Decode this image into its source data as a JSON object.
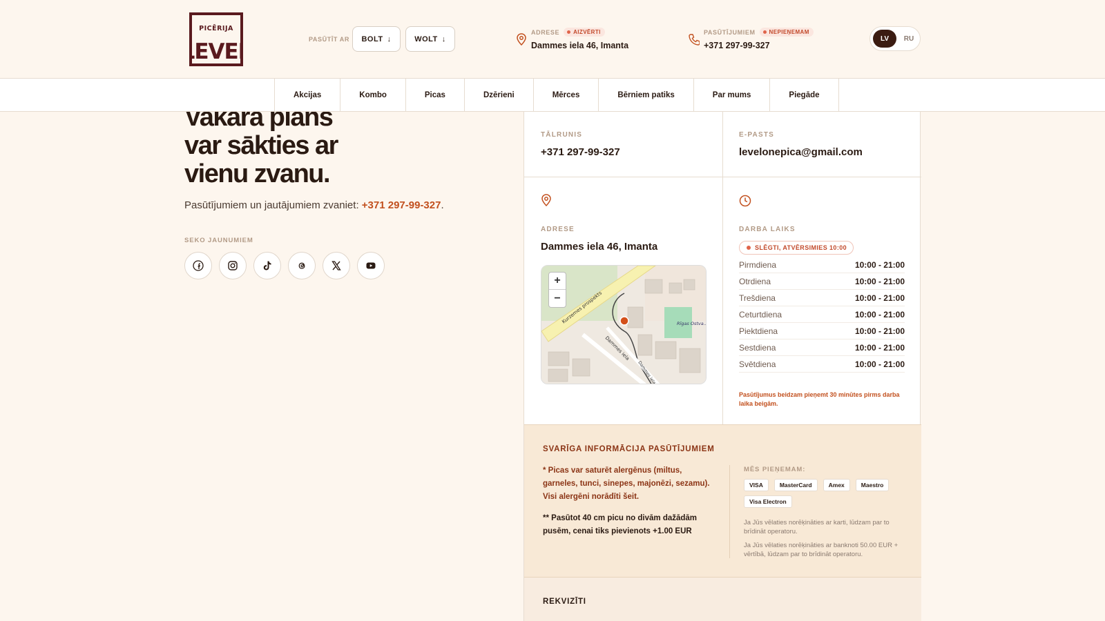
{
  "header": {
    "logo_text_top": "PICĒRIJA",
    "logo_text_main": "LEVEL",
    "order_label": "PASŪTĪT AR",
    "bolt_label": "BOLT",
    "wolt_label": "WOLT",
    "arrow": "↓",
    "address": {
      "label": "ADRESE",
      "badge": "AIZVĒRTI",
      "value": "Dammes iela 46, Imanta"
    },
    "orders": {
      "label": "PASŪTĪJUMIEM",
      "badge": "NEPIEŅEMAM",
      "value": "+371 297-99-327"
    },
    "lang_active": "LV",
    "lang_other": "RU"
  },
  "nav": {
    "items": [
      "Akcijas",
      "Kombo",
      "Picas",
      "Dzērieni",
      "Mērces",
      "Bērniem patiks",
      "Par mums",
      "Piegāde"
    ]
  },
  "hero": {
    "line1": "Vakara plāns",
    "line2": "var sākties ar",
    "line3": "vienu zvanu.",
    "call_prefix": "Pasūtījumiem un jautājumiem zvaniet: ",
    "call_phone": "+371 297-99-327",
    "call_suffix": ".",
    "follow_label": "SEKO JAUNUMIEM"
  },
  "socials": [
    "facebook-icon",
    "instagram-icon",
    "tiktok-icon",
    "threads-icon",
    "x-icon",
    "youtube-icon"
  ],
  "contact": {
    "phone_label": "TĀLRUNIS",
    "phone_value": "+371 297-99-327",
    "email_label": "E-PASTS",
    "email_value": "levelonepica@gmail.com",
    "address_label": "ADRESE",
    "address_value": "Dammes iela 46, Imanta",
    "map": {
      "zoom_in": "+",
      "zoom_out": "−",
      "street1": "Kurzemes prospekts",
      "street2": "Dammes iela",
      "street3": "Dammes iela",
      "poi": "Rīgas Ostva... vidusskol..."
    },
    "hours_label": "DARBA LAIKS",
    "status": "SLĒGTI, ATVĒRSIMIES 10:00",
    "hours": [
      {
        "day": "Pirmdiena",
        "time": "10:00 - 21:00"
      },
      {
        "day": "Otrdiena",
        "time": "10:00 - 21:00"
      },
      {
        "day": "Trešdiena",
        "time": "10:00 - 21:00"
      },
      {
        "day": "Ceturtdiena",
        "time": "10:00 - 21:00"
      },
      {
        "day": "Piektdiena",
        "time": "10:00 - 21:00"
      },
      {
        "day": "Sestdiena",
        "time": "10:00 - 21:00"
      },
      {
        "day": "Svētdiena",
        "time": "10:00 - 21:00"
      }
    ],
    "hours_note": "Pasūtījumus beidzam pieņemt 30 minūtes pirms darba laika beigām."
  },
  "info": {
    "title": "SVARĪGA INFORMĀCIJA PASŪTĪJUMIEM",
    "allergen": "* Picas var saturēt alergēnus (miltus, garneles, tunci, sinepes, majonēzi, sezamu). Visi alergēni norādīti šeit.",
    "pizza_note": "** Pasūtot 40 cm picu no divām dažādām pusēm, cenai tiks pievienots +1.00 EUR",
    "accept_label": "MĒS PIEŅEMAM:",
    "cards": [
      "VISA",
      "MasterCard",
      "Amex",
      "Maestro",
      "Visa Electron"
    ],
    "fine1": "Ja Jūs vēlaties norēķināties ar karti, lūdzam par to brīdināt operatoru.",
    "fine2": "Ja Jūs vēlaties norēķināties ar banknoti 50.00 EUR + vērtībā, lūdzam par to brīdināt operatoru."
  },
  "rekviziti": {
    "title": "REKVIZĪTI"
  },
  "colors": {
    "accent": "#c2501e",
    "dark": "#2a1a12",
    "logo": "#5a1a1e"
  }
}
